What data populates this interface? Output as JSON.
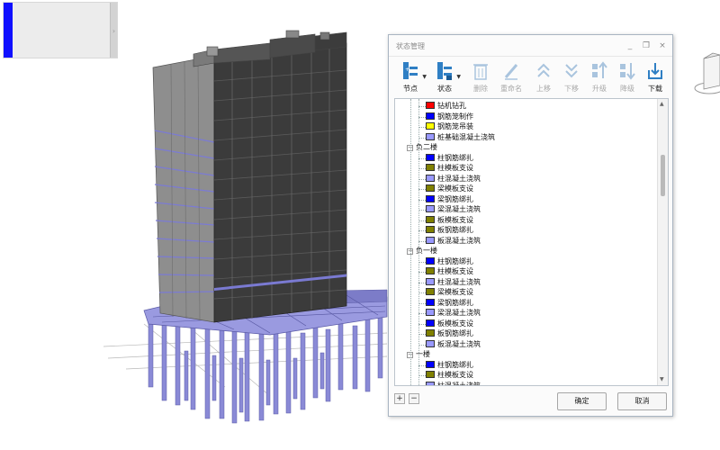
{
  "dialog": {
    "title": "状态管理",
    "window_buttons": {
      "minimize": "_",
      "maximize": "❐",
      "close": "×"
    },
    "toolbar": [
      {
        "name": "node",
        "label": "节点",
        "icon": "tree-node-icon",
        "enabled": true,
        "dropdown": true
      },
      {
        "name": "state",
        "label": "状态",
        "icon": "tree-state-icon",
        "enabled": true,
        "dropdown": true
      },
      {
        "name": "delete",
        "label": "删除",
        "icon": "trash-icon",
        "enabled": false
      },
      {
        "name": "rename",
        "label": "重命名",
        "icon": "pencil-icon",
        "enabled": false
      },
      {
        "name": "move-up",
        "label": "上移",
        "icon": "double-chevron-up-icon",
        "enabled": false
      },
      {
        "name": "move-down",
        "label": "下移",
        "icon": "double-chevron-down-icon",
        "enabled": false
      },
      {
        "name": "promote",
        "label": "升级",
        "icon": "promote-icon",
        "enabled": false
      },
      {
        "name": "demote",
        "label": "降级",
        "icon": "demote-icon",
        "enabled": false
      },
      {
        "name": "download",
        "label": "下载",
        "icon": "download-icon",
        "enabled": true
      }
    ],
    "tree": [
      {
        "type": "item",
        "label": "钻机钻孔",
        "color": "#ff0000"
      },
      {
        "type": "item",
        "label": "钢筋笼制作",
        "color": "#0000ff"
      },
      {
        "type": "item",
        "label": "钢筋笼吊装",
        "color": "#ffff00"
      },
      {
        "type": "item",
        "label": "桩基础混凝土浇筑",
        "color": "#9999ff"
      },
      {
        "type": "group",
        "label": "负二楼",
        "expanded": true
      },
      {
        "type": "item",
        "label": "柱钢筋绑扎",
        "color": "#0000ff"
      },
      {
        "type": "item",
        "label": "柱模板支设",
        "color": "#808000"
      },
      {
        "type": "item",
        "label": "柱混凝土浇筑",
        "color": "#9999ff"
      },
      {
        "type": "item",
        "label": "梁模板支设",
        "color": "#808000"
      },
      {
        "type": "item",
        "label": "梁钢筋绑扎",
        "color": "#0000ff"
      },
      {
        "type": "item",
        "label": "梁混凝土浇筑",
        "color": "#9999ff"
      },
      {
        "type": "item",
        "label": "板模板支设",
        "color": "#808000"
      },
      {
        "type": "item",
        "label": "板钢筋绑扎",
        "color": "#808000"
      },
      {
        "type": "item",
        "label": "板混凝土浇筑",
        "color": "#9999ff"
      },
      {
        "type": "group",
        "label": "负一楼",
        "expanded": true
      },
      {
        "type": "item",
        "label": "柱钢筋绑扎",
        "color": "#0000ff"
      },
      {
        "type": "item",
        "label": "柱模板支设",
        "color": "#808000"
      },
      {
        "type": "item",
        "label": "柱混凝土浇筑",
        "color": "#9999ff"
      },
      {
        "type": "item",
        "label": "梁模板支设",
        "color": "#808000"
      },
      {
        "type": "item",
        "label": "梁钢筋绑扎",
        "color": "#0000ff"
      },
      {
        "type": "item",
        "label": "梁混凝土浇筑",
        "color": "#9999ff"
      },
      {
        "type": "item",
        "label": "板模板支设",
        "color": "#0000ff"
      },
      {
        "type": "item",
        "label": "板钢筋绑扎",
        "color": "#808000"
      },
      {
        "type": "item",
        "label": "板混凝土浇筑",
        "color": "#9999ff"
      },
      {
        "type": "group",
        "label": "一楼",
        "expanded": true
      },
      {
        "type": "item",
        "label": "柱钢筋绑扎",
        "color": "#0000ff"
      },
      {
        "type": "item",
        "label": "柱模板支设",
        "color": "#808000"
      },
      {
        "type": "item",
        "label": "柱混凝土浇筑",
        "color": "#9999ff"
      }
    ],
    "add_button": "+",
    "remove_button": "−",
    "ok_button": "确定",
    "cancel_button": "取消"
  },
  "colors": {
    "accent": "#1010ff",
    "building_dark": "#3a3a3a",
    "building_light": "#8d8d8d",
    "structure_blue": "#8a8ad6",
    "toolbar_icon": "#2f7fc4"
  }
}
